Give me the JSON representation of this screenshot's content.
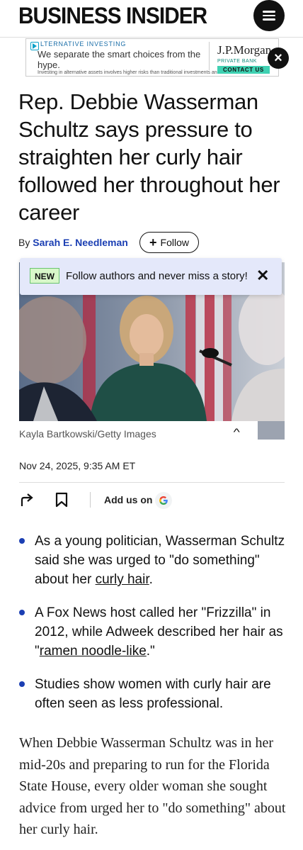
{
  "header": {
    "logo": "BUSINESS INSIDER",
    "menu_icon": "hamburger-menu-icon"
  },
  "ad": {
    "sponsor_label": "LTERNATIVE INVESTING",
    "headline": "We separate the smart choices from the hype.",
    "fine_print": "Investing in alternative assets involves higher risks than traditional investments and is not suitable",
    "brand": "J.P.Morgan",
    "brand_sub": "PRIVATE BANK",
    "cta": "CONTACT US",
    "close_icon": "close-icon"
  },
  "article": {
    "headline": "Rep. Debbie Wasserman Schultz says pressure to straighten her curly hair followed her throughout her career",
    "byline_prefix": "By",
    "author": "Sarah E. Needleman",
    "follow_label": "Follow",
    "photo_caption": "Kayla Bartkowski/Getty Images",
    "date": "Nov 24, 2025, 9:35 AM ET",
    "add_us_label": "Add us on",
    "bullets": [
      {
        "before": "As a young politician, Wasserman Schultz said she was urged to \"do something\" about her ",
        "link": "curly hair",
        "after": "."
      },
      {
        "before": "A Fox News host called her \"Frizzilla\" in 2012, while Adweek described her hair as \"",
        "link": "ramen noodle-like",
        "after": ".\""
      },
      {
        "before": "Studies show women with curly hair are often seen as less professional.",
        "link": "",
        "after": ""
      }
    ],
    "body": "When Debbie Wasserman Schultz was in her mid-20s and preparing to run for the Florida State House, every older woman she sought advice from urged her to \"do something\" about her curly hair."
  },
  "toast": {
    "badge": "NEW",
    "message": "Follow authors and never miss a story!"
  },
  "colors": {
    "accent_blue": "#1b3fb3",
    "new_badge_bg": "#d8f7c9",
    "toast_bg": "#e4e8fa",
    "ad_cta": "#3fd1b2"
  }
}
